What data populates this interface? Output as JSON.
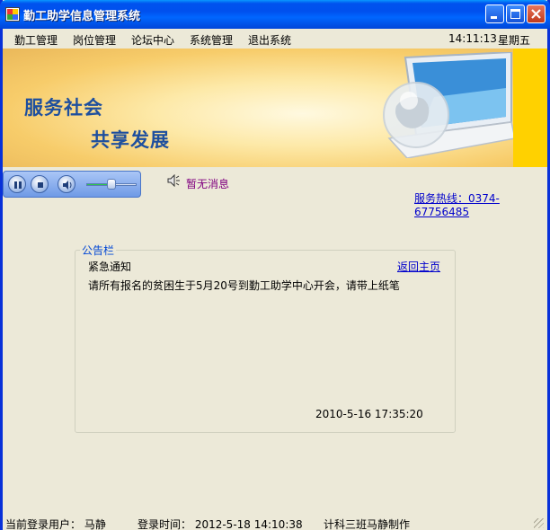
{
  "window": {
    "title": "勤工助学信息管理系统"
  },
  "menu": {
    "items": [
      "勤工管理",
      "岗位管理",
      "论坛中心",
      "系统管理",
      "退出系统"
    ],
    "time": "14:11:13",
    "weekday": "星期五"
  },
  "banner": {
    "slogan_line1": "服务社会",
    "slogan_line2": "共享发展"
  },
  "player": {
    "message": "暂无消息",
    "volume": 0.45
  },
  "hotline": "服务热线：0374-67756485",
  "announcement": {
    "legend": "公告栏",
    "title": "紧急通知",
    "back_link": "返回主页",
    "body": "请所有报名的贫困生于5月20号到勤工助学中心开会，请带上纸笔",
    "timestamp": "2010-5-16  17:35:20"
  },
  "status": {
    "current_user": "当前登录用户： 马静",
    "login_time": "登录时间： 2012-5-18 14:10:38",
    "credit": "计科三班马静制作"
  },
  "colors": {
    "title_bar": "#0053ee",
    "link": "#0000cc",
    "slogan": "#1e4f9e",
    "message": "#800080",
    "legend": "#0046d5"
  }
}
